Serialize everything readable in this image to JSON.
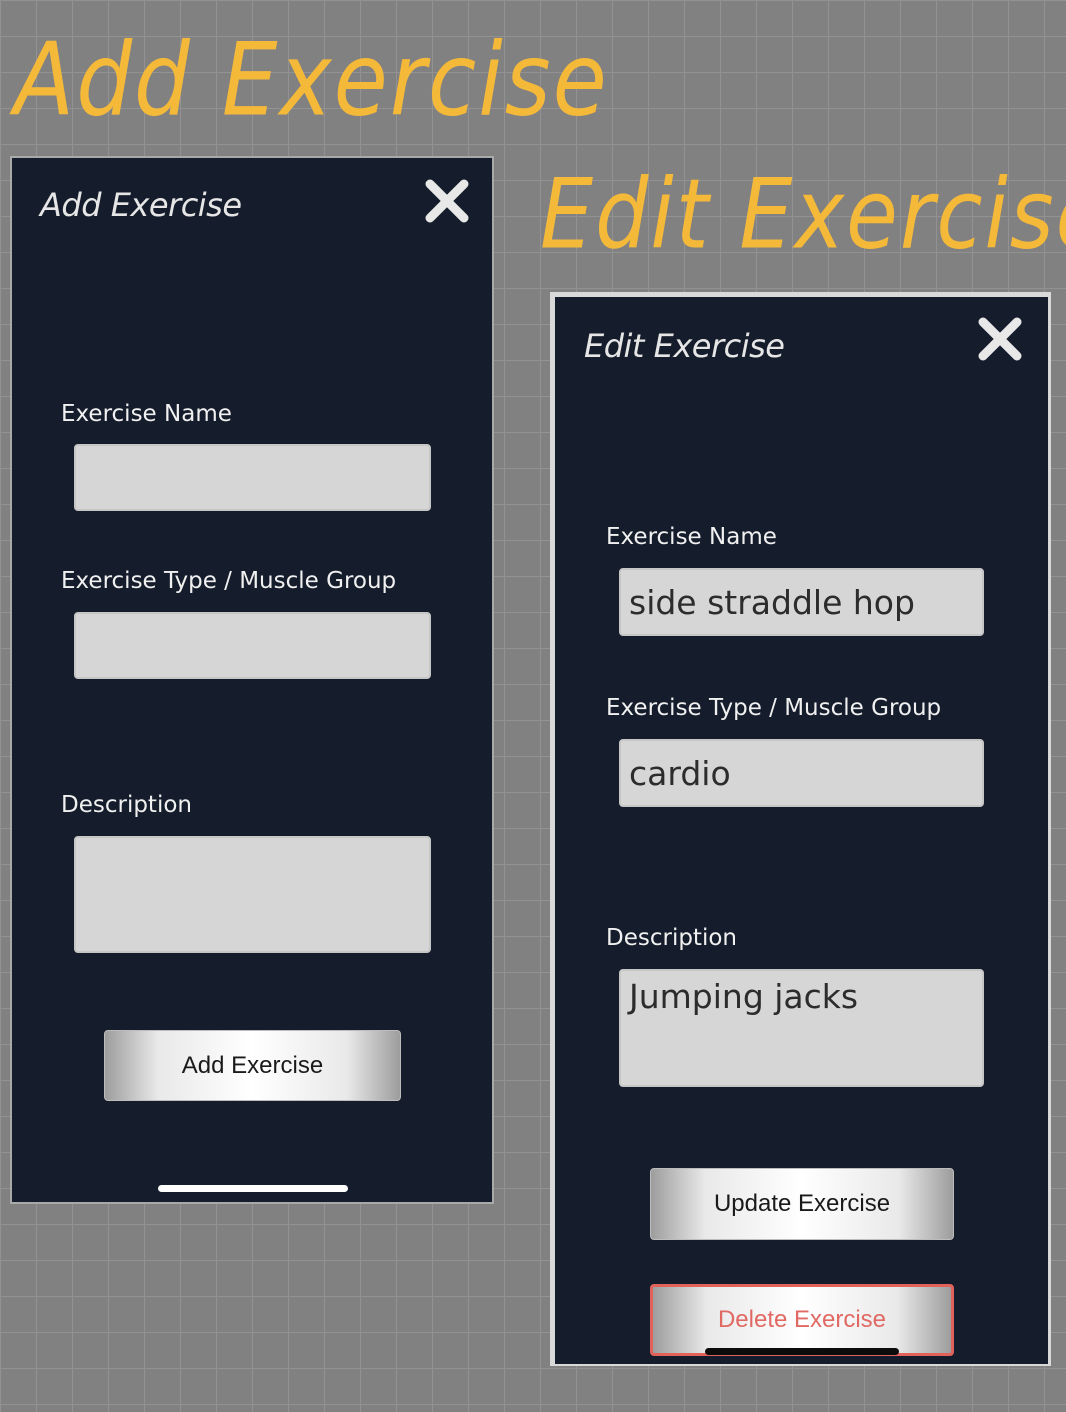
{
  "annotations": {
    "add_heading": "Add Exercise",
    "edit_heading": "Edit Exercise"
  },
  "add_screen": {
    "title": "Add Exercise",
    "close_icon": "close-icon",
    "name_label": "Exercise Name",
    "name_value": "",
    "type_label": "Exercise Type / Muscle Group",
    "type_value": "",
    "description_label": "Description",
    "description_value": "",
    "submit_label": "Add Exercise"
  },
  "edit_screen": {
    "title": "Edit Exercise",
    "close_icon": "close-icon",
    "name_label": "Exercise Name",
    "name_value": "side straddle hop",
    "type_label": "Exercise Type / Muscle Group",
    "type_value": "cardio",
    "description_label": "Description",
    "description_value": "Jumping jacks",
    "update_label": "Update Exercise",
    "delete_label": "Delete Exercise"
  },
  "colors": {
    "background": "#818181",
    "screen_bg": "#151c2b",
    "annotation": "#f5b93a",
    "input_bg": "#d6d6d6",
    "delete_accent": "#e0625a"
  }
}
